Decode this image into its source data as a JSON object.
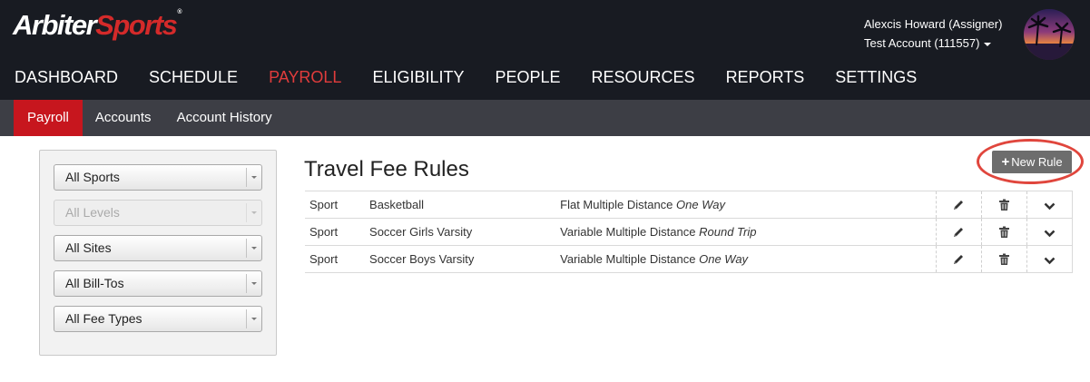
{
  "header": {
    "logo": {
      "part1": "Arbiter",
      "part2": "Sports",
      "tm": "®"
    },
    "user_name": "Alexcis Howard (Assigner)",
    "account": "Test Account (111557)"
  },
  "nav": {
    "items": [
      {
        "label": "DASHBOARD"
      },
      {
        "label": "SCHEDULE"
      },
      {
        "label": "PAYROLL",
        "active": true
      },
      {
        "label": "ELIGIBILITY"
      },
      {
        "label": "PEOPLE"
      },
      {
        "label": "RESOURCES"
      },
      {
        "label": "REPORTS"
      },
      {
        "label": "SETTINGS"
      }
    ]
  },
  "subnav": {
    "items": [
      {
        "label": "Payroll",
        "active": true
      },
      {
        "label": "Accounts"
      },
      {
        "label": "Account History"
      }
    ]
  },
  "filters": {
    "sports": "All Sports",
    "levels": "All Levels",
    "sites": "All Sites",
    "billtos": "All Bill-Tos",
    "feetypes": "All Fee Types"
  },
  "main": {
    "title": "Travel Fee Rules",
    "new_rule_label": "New Rule",
    "rows": [
      {
        "type": "Sport",
        "name": "Basketball",
        "rule": "Flat Multiple Distance",
        "direction": "One Way"
      },
      {
        "type": "Sport",
        "name": "Soccer Girls Varsity",
        "rule": "Variable Multiple Distance",
        "direction": "Round Trip"
      },
      {
        "type": "Sport",
        "name": "Soccer Boys Varsity",
        "rule": "Variable Multiple Distance",
        "direction": "One Way"
      }
    ]
  },
  "colors": {
    "header_bg": "#181b22",
    "subnav_bg": "#3d3e45",
    "accent_red": "#c7161e",
    "active_nav_text": "#e03c3c",
    "highlight_circle": "#e0463d",
    "new_rule_bg": "#6d6d6d"
  },
  "icons": [
    "pencil-icon",
    "trash-icon",
    "chevron-down-icon",
    "plus-icon",
    "caret-down-icon"
  ]
}
